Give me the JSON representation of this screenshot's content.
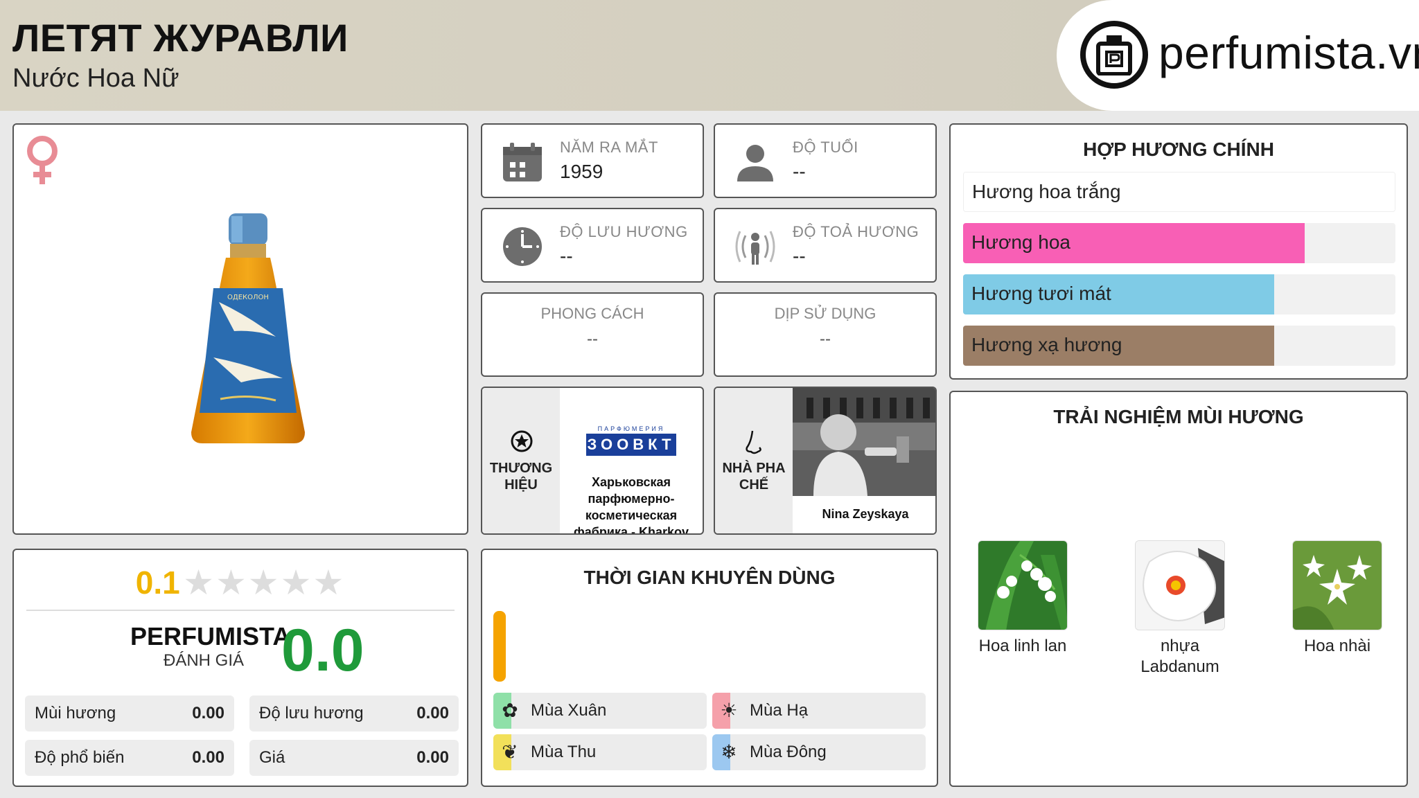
{
  "header": {
    "title": "ЛЕТЯТ ЖУРАВЛИ",
    "subtitle": "Nước Hoa Nữ",
    "logo_text": "perfumista.vn"
  },
  "info": {
    "launch_year": {
      "label": "NĂM RA MẮT",
      "value": "1959"
    },
    "age": {
      "label": "ĐỘ TUỔI",
      "value": "--"
    },
    "longevity": {
      "label": "ĐỘ LƯU HƯƠNG",
      "value": "--"
    },
    "sillage": {
      "label": "ĐỘ TOẢ HƯƠNG",
      "value": "--"
    },
    "style": {
      "label": "PHONG CÁCH",
      "value": "--"
    },
    "occasion": {
      "label": "DỊP SỬ DỤNG",
      "value": "--"
    }
  },
  "brand": {
    "label_line1": "THƯƠNG",
    "label_line2": "HIỆU",
    "logo_text": "ЗООВКТ",
    "logo_caption": "ПАРФЮМЕРИЯ",
    "name": "Харьковская парфюмерно-косметическая фабрика - Kharkov perfume"
  },
  "perfumer": {
    "label_line1": "NHÀ PHA",
    "label_line2": "CHẾ",
    "name": "Nina Zeyskaya"
  },
  "accords": {
    "title": "HỢP HƯƠNG CHÍNH",
    "items": [
      {
        "label": "Hương hoa trắng",
        "percent": 100,
        "color": "#ffffff"
      },
      {
        "label": "Hương hoa",
        "percent": 79,
        "color": "#f85fb5"
      },
      {
        "label": "Hương tươi mát",
        "percent": 72,
        "color": "#7fcbe6"
      },
      {
        "label": "Hương xạ hương",
        "percent": 72,
        "color": "#9b7e66"
      }
    ]
  },
  "experience": {
    "title": "TRẢI NGHIỆM MÙI HƯƠNG",
    "notes": [
      {
        "label": "Hoa linh lan",
        "icon": "lily-of-the-valley"
      },
      {
        "label": "nhựa Labdanum",
        "icon": "labdanum-flower"
      },
      {
        "label": "Hoa nhài",
        "icon": "jasmine-flower"
      }
    ]
  },
  "rating": {
    "value": "0.1",
    "stars": 0.1,
    "perfumista_label": "PERFUMISTA",
    "perfumista_sub": "ĐÁNH GIÁ",
    "perfumista_score": "0.0",
    "metrics": [
      {
        "label": "Mùi hương",
        "value": "0.00"
      },
      {
        "label": "Độ lưu hương",
        "value": "0.00"
      },
      {
        "label": "Độ phổ biến",
        "value": "0.00"
      },
      {
        "label": "Giá",
        "value": "0.00"
      }
    ]
  },
  "seasons": {
    "title": "THỜI GIAN KHUYÊN DÙNG",
    "items": [
      {
        "label": "Mùa Xuân",
        "color": "#8fe0a8",
        "icon": "flower-icon"
      },
      {
        "label": "Mùa Hạ",
        "color": "#f5a0aa",
        "icon": "sun-icon"
      },
      {
        "label": "Mùa Thu",
        "color": "#f2e05a",
        "icon": "leaf-icon"
      },
      {
        "label": "Mùa Đông",
        "color": "#9cc8f0",
        "icon": "snowflake-icon"
      }
    ]
  },
  "colors": {
    "score_green": "#1f9a3a",
    "rating_gold": "#f0b400",
    "venus_pink": "#e88c95",
    "day_bar": "#f5a300"
  }
}
